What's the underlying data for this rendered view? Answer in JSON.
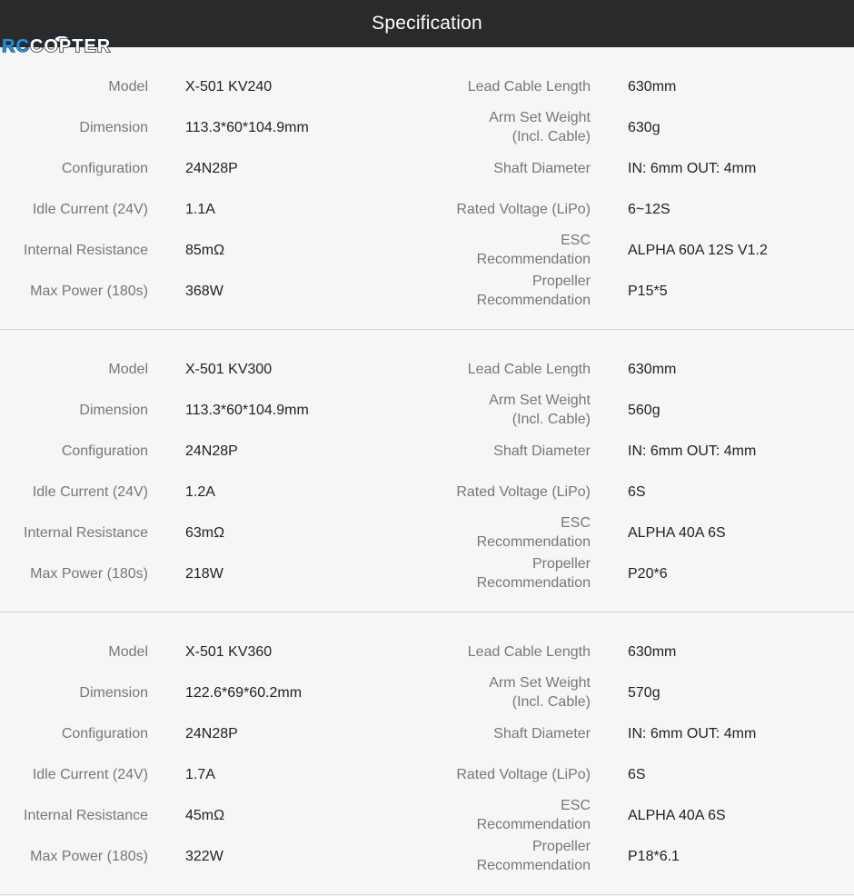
{
  "header": {
    "title": "Specification"
  },
  "logo": {
    "rc": "RC",
    "copter": "COPTER"
  },
  "labels": {
    "model": "Model",
    "dimension": "Dimension",
    "configuration": "Configuration",
    "idle_current": "Idle Current (24V)",
    "internal_resistance": "Internal Resistance",
    "max_power": "Max Power (180s)",
    "lead_cable_length": "Lead Cable Length",
    "arm_set_weight_1": "Arm Set Weight",
    "arm_set_weight_2": "(Incl. Cable)",
    "shaft_diameter": "Shaft Diameter",
    "rated_voltage": "Rated Voltage (LiPo)",
    "esc_1": "ESC",
    "esc_2": "Recommendation",
    "propeller_1": "Propeller",
    "propeller_2": "Recommendation"
  },
  "sections": [
    {
      "model": "X-501 KV240",
      "dimension": "113.3*60*104.9mm",
      "configuration": "24N28P",
      "idle_current": "1.1A",
      "internal_resistance": "85mΩ",
      "max_power": "368W",
      "lead_cable_length": "630mm",
      "arm_set_weight": "630g",
      "shaft_diameter": "IN: 6mm OUT: 4mm",
      "rated_voltage": "6~12S",
      "esc": "ALPHA 60A 12S V1.2",
      "propeller": "P15*5"
    },
    {
      "model": "X-501 KV300",
      "dimension": "113.3*60*104.9mm",
      "configuration": "24N28P",
      "idle_current": "1.2A",
      "internal_resistance": "63mΩ",
      "max_power": "218W",
      "lead_cable_length": "630mm",
      "arm_set_weight": "560g",
      "shaft_diameter": "IN: 6mm OUT: 4mm",
      "rated_voltage": "6S",
      "esc": "ALPHA 40A 6S",
      "propeller": "P20*6"
    },
    {
      "model": "X-501 KV360",
      "dimension": "122.6*69*60.2mm",
      "configuration": "24N28P",
      "idle_current": "1.7A",
      "internal_resistance": "45mΩ",
      "max_power": "322W",
      "lead_cable_length": "630mm",
      "arm_set_weight": "570g",
      "shaft_diameter": "IN: 6mm OUT: 4mm",
      "rated_voltage": "6S",
      "esc": "ALPHA 40A 6S",
      "propeller": "P18*6.1"
    }
  ]
}
